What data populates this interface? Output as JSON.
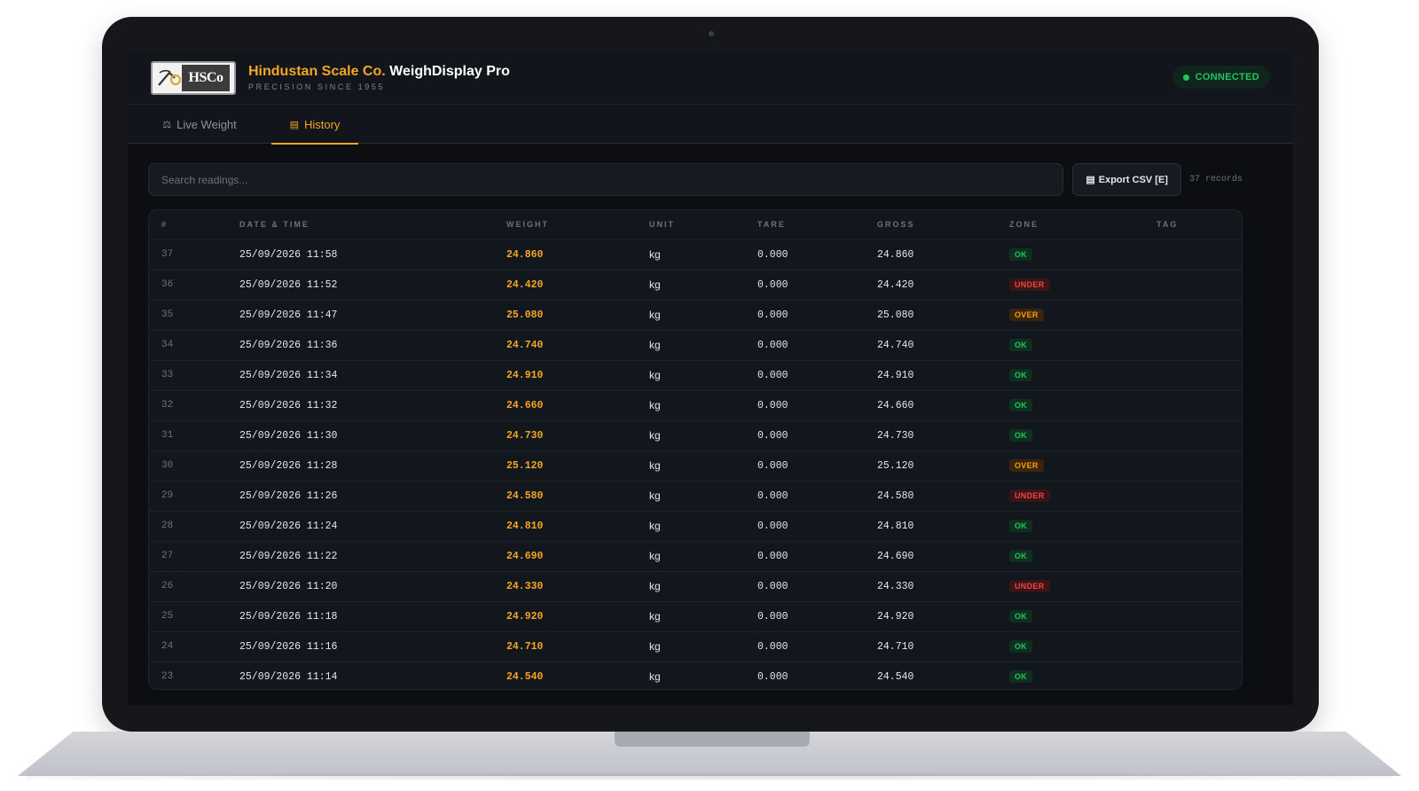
{
  "app": {
    "brand_company": "Hindustan Scale Co.",
    "brand_product": "WeighDisplay Pro",
    "tagline": "PRECISION SINCE 1955",
    "logo_text": "HSCo",
    "status": "CONNECTED"
  },
  "tabs": [
    {
      "label": "Live Weight",
      "icon": "scale-icon",
      "active": false
    },
    {
      "label": "History",
      "icon": "list-icon",
      "active": true
    }
  ],
  "toolbar": {
    "search_placeholder": "Search readings...",
    "export_label": "Export CSV [E]",
    "record_count": "37 records"
  },
  "table": {
    "columns": [
      "#",
      "DATE & TIME",
      "WEIGHT",
      "UNIT",
      "TARE",
      "GROSS",
      "ZONE",
      "TAG"
    ],
    "rows": [
      {
        "num": "37",
        "datetime": "25/09/2026 11:58",
        "weight": "24.860",
        "unit": "kg",
        "tare": "0.000",
        "gross": "24.860",
        "zone": "OK",
        "tag": ""
      },
      {
        "num": "36",
        "datetime": "25/09/2026 11:52",
        "weight": "24.420",
        "unit": "kg",
        "tare": "0.000",
        "gross": "24.420",
        "zone": "UNDER",
        "tag": ""
      },
      {
        "num": "35",
        "datetime": "25/09/2026 11:47",
        "weight": "25.080",
        "unit": "kg",
        "tare": "0.000",
        "gross": "25.080",
        "zone": "OVER",
        "tag": ""
      },
      {
        "num": "34",
        "datetime": "25/09/2026 11:36",
        "weight": "24.740",
        "unit": "kg",
        "tare": "0.000",
        "gross": "24.740",
        "zone": "OK",
        "tag": ""
      },
      {
        "num": "33",
        "datetime": "25/09/2026 11:34",
        "weight": "24.910",
        "unit": "kg",
        "tare": "0.000",
        "gross": "24.910",
        "zone": "OK",
        "tag": ""
      },
      {
        "num": "32",
        "datetime": "25/09/2026 11:32",
        "weight": "24.660",
        "unit": "kg",
        "tare": "0.000",
        "gross": "24.660",
        "zone": "OK",
        "tag": ""
      },
      {
        "num": "31",
        "datetime": "25/09/2026 11:30",
        "weight": "24.730",
        "unit": "kg",
        "tare": "0.000",
        "gross": "24.730",
        "zone": "OK",
        "tag": ""
      },
      {
        "num": "30",
        "datetime": "25/09/2026 11:28",
        "weight": "25.120",
        "unit": "kg",
        "tare": "0.000",
        "gross": "25.120",
        "zone": "OVER",
        "tag": ""
      },
      {
        "num": "29",
        "datetime": "25/09/2026 11:26",
        "weight": "24.580",
        "unit": "kg",
        "tare": "0.000",
        "gross": "24.580",
        "zone": "UNDER",
        "tag": ""
      },
      {
        "num": "28",
        "datetime": "25/09/2026 11:24",
        "weight": "24.810",
        "unit": "kg",
        "tare": "0.000",
        "gross": "24.810",
        "zone": "OK",
        "tag": ""
      },
      {
        "num": "27",
        "datetime": "25/09/2026 11:22",
        "weight": "24.690",
        "unit": "kg",
        "tare": "0.000",
        "gross": "24.690",
        "zone": "OK",
        "tag": ""
      },
      {
        "num": "26",
        "datetime": "25/09/2026 11:20",
        "weight": "24.330",
        "unit": "kg",
        "tare": "0.000",
        "gross": "24.330",
        "zone": "UNDER",
        "tag": ""
      },
      {
        "num": "25",
        "datetime": "25/09/2026 11:18",
        "weight": "24.920",
        "unit": "kg",
        "tare": "0.000",
        "gross": "24.920",
        "zone": "OK",
        "tag": ""
      },
      {
        "num": "24",
        "datetime": "25/09/2026 11:16",
        "weight": "24.710",
        "unit": "kg",
        "tare": "0.000",
        "gross": "24.710",
        "zone": "OK",
        "tag": ""
      },
      {
        "num": "23",
        "datetime": "25/09/2026 11:14",
        "weight": "24.540",
        "unit": "kg",
        "tare": "0.000",
        "gross": "24.540",
        "zone": "OK",
        "tag": ""
      }
    ]
  },
  "colors": {
    "accent": "#f5a623",
    "ok": "#22c55e",
    "under": "#ef4444",
    "over": "#f59e0b",
    "background": "#0c0e12"
  }
}
